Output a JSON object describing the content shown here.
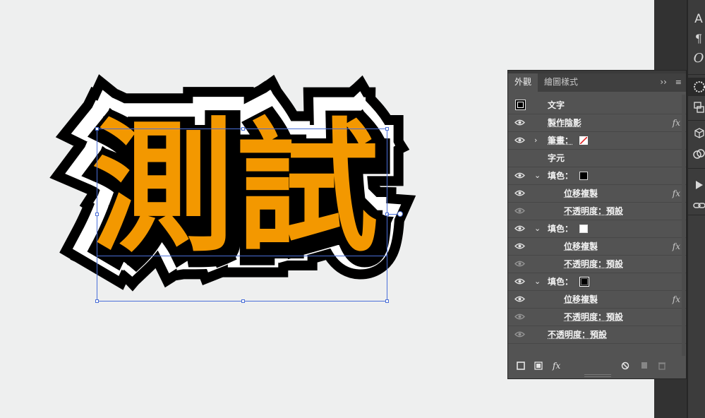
{
  "artwork": {
    "text": "測試",
    "fill_color": "#f39800",
    "stroke_inner_color": "#ffffff",
    "stroke_outer_color": "#000000"
  },
  "panel": {
    "tabs": [
      "外觀",
      "繪圖樣式"
    ],
    "rows": [
      {
        "label": "文字",
        "type": "object"
      },
      {
        "label": "製作陰影",
        "type": "effect",
        "fx": "fx"
      },
      {
        "label": "筆畫：",
        "type": "stroke",
        "swatch": "none"
      },
      {
        "label": "字元",
        "type": "group"
      },
      {
        "label": "填色：",
        "type": "fill",
        "swatch": "#000000"
      },
      {
        "label": "位移複製",
        "type": "effect",
        "fx": "fx"
      },
      {
        "label": "不透明度：預設",
        "type": "opacity"
      },
      {
        "label": "填色：",
        "type": "fill",
        "swatch": "#ffffff"
      },
      {
        "label": "位移複製",
        "type": "effect",
        "fx": "fx"
      },
      {
        "label": "不透明度：預設",
        "type": "opacity"
      },
      {
        "label": "填色：",
        "type": "fill",
        "swatch": "#000000"
      },
      {
        "label": "位移複製",
        "type": "effect",
        "fx": "fx"
      },
      {
        "label": "不透明度：預設",
        "type": "opacity"
      },
      {
        "label": "不透明度：預設",
        "type": "opacity"
      }
    ],
    "footer_fx": "fx"
  },
  "toolbar": {
    "icons": [
      "character-icon",
      "paragraph-icon",
      "opentype-icon",
      "appearance-icon",
      "transform-icon",
      "3d-icon",
      "libraries-icon",
      "actions-icon",
      "links-icon"
    ],
    "glyphs": [
      "A",
      "¶",
      "O"
    ]
  }
}
